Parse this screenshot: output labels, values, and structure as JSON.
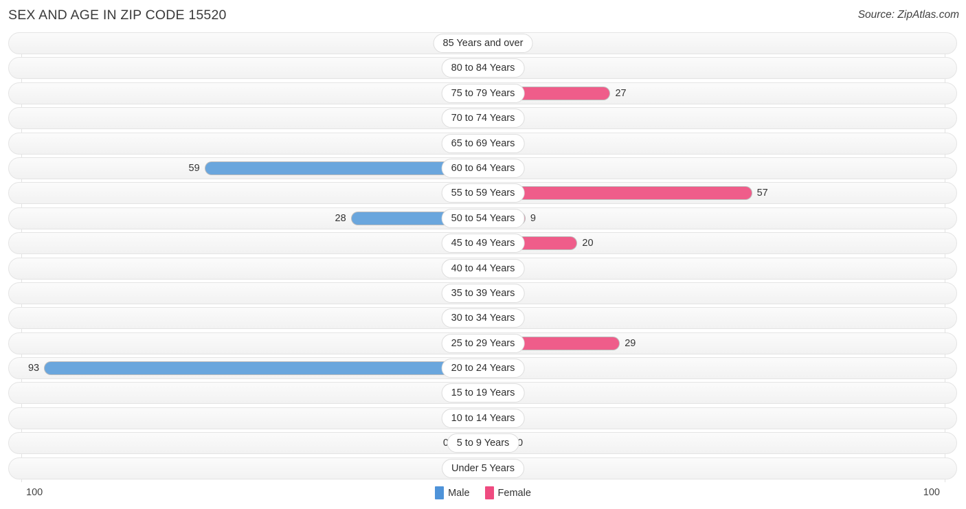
{
  "header": {
    "title": "SEX AND AGE IN ZIP CODE 15520",
    "source": "Source: ZipAtlas.com"
  },
  "axis": {
    "left_max": "100",
    "right_max": "100"
  },
  "legend": {
    "items": [
      {
        "label": "Male",
        "color": "#4e93d9"
      },
      {
        "label": "Female",
        "color": "#ef4b80"
      }
    ]
  },
  "colors": {
    "male": "#6aa6dd",
    "male_zero": "#a8c8e8",
    "female": "#ef5d8a",
    "female_zero": "#f6a6c0",
    "track": "#f5f5f5",
    "gridline": "#e2e2e2"
  },
  "chart_data": {
    "type": "bar",
    "title": "SEX AND AGE IN ZIP CODE 15520",
    "subtitle": "",
    "orientation": "horizontal",
    "style": "population-pyramid",
    "xlabel": "",
    "ylabel": "",
    "xlim": [
      100,
      100
    ],
    "grid": true,
    "legend_position": "bottom-center",
    "categories": [
      "85 Years and over",
      "80 to 84 Years",
      "75 to 79 Years",
      "70 to 74 Years",
      "65 to 69 Years",
      "60 to 64 Years",
      "55 to 59 Years",
      "50 to 54 Years",
      "45 to 49 Years",
      "40 to 44 Years",
      "35 to 39 Years",
      "30 to 34 Years",
      "25 to 29 Years",
      "20 to 24 Years",
      "15 to 19 Years",
      "10 to 14 Years",
      "5 to 9 Years",
      "Under 5 Years"
    ],
    "series": [
      {
        "name": "Male",
        "color": "#6aa6dd",
        "values": [
          0,
          0,
          0,
          0,
          0,
          59,
          0,
          28,
          0,
          0,
          0,
          0,
          0,
          93,
          0,
          0,
          0,
          0
        ]
      },
      {
        "name": "Female",
        "color": "#ef5d8a",
        "values": [
          0,
          0,
          27,
          0,
          0,
          0,
          57,
          9,
          20,
          0,
          0,
          0,
          29,
          0,
          0,
          0,
          0,
          0
        ]
      }
    ]
  }
}
